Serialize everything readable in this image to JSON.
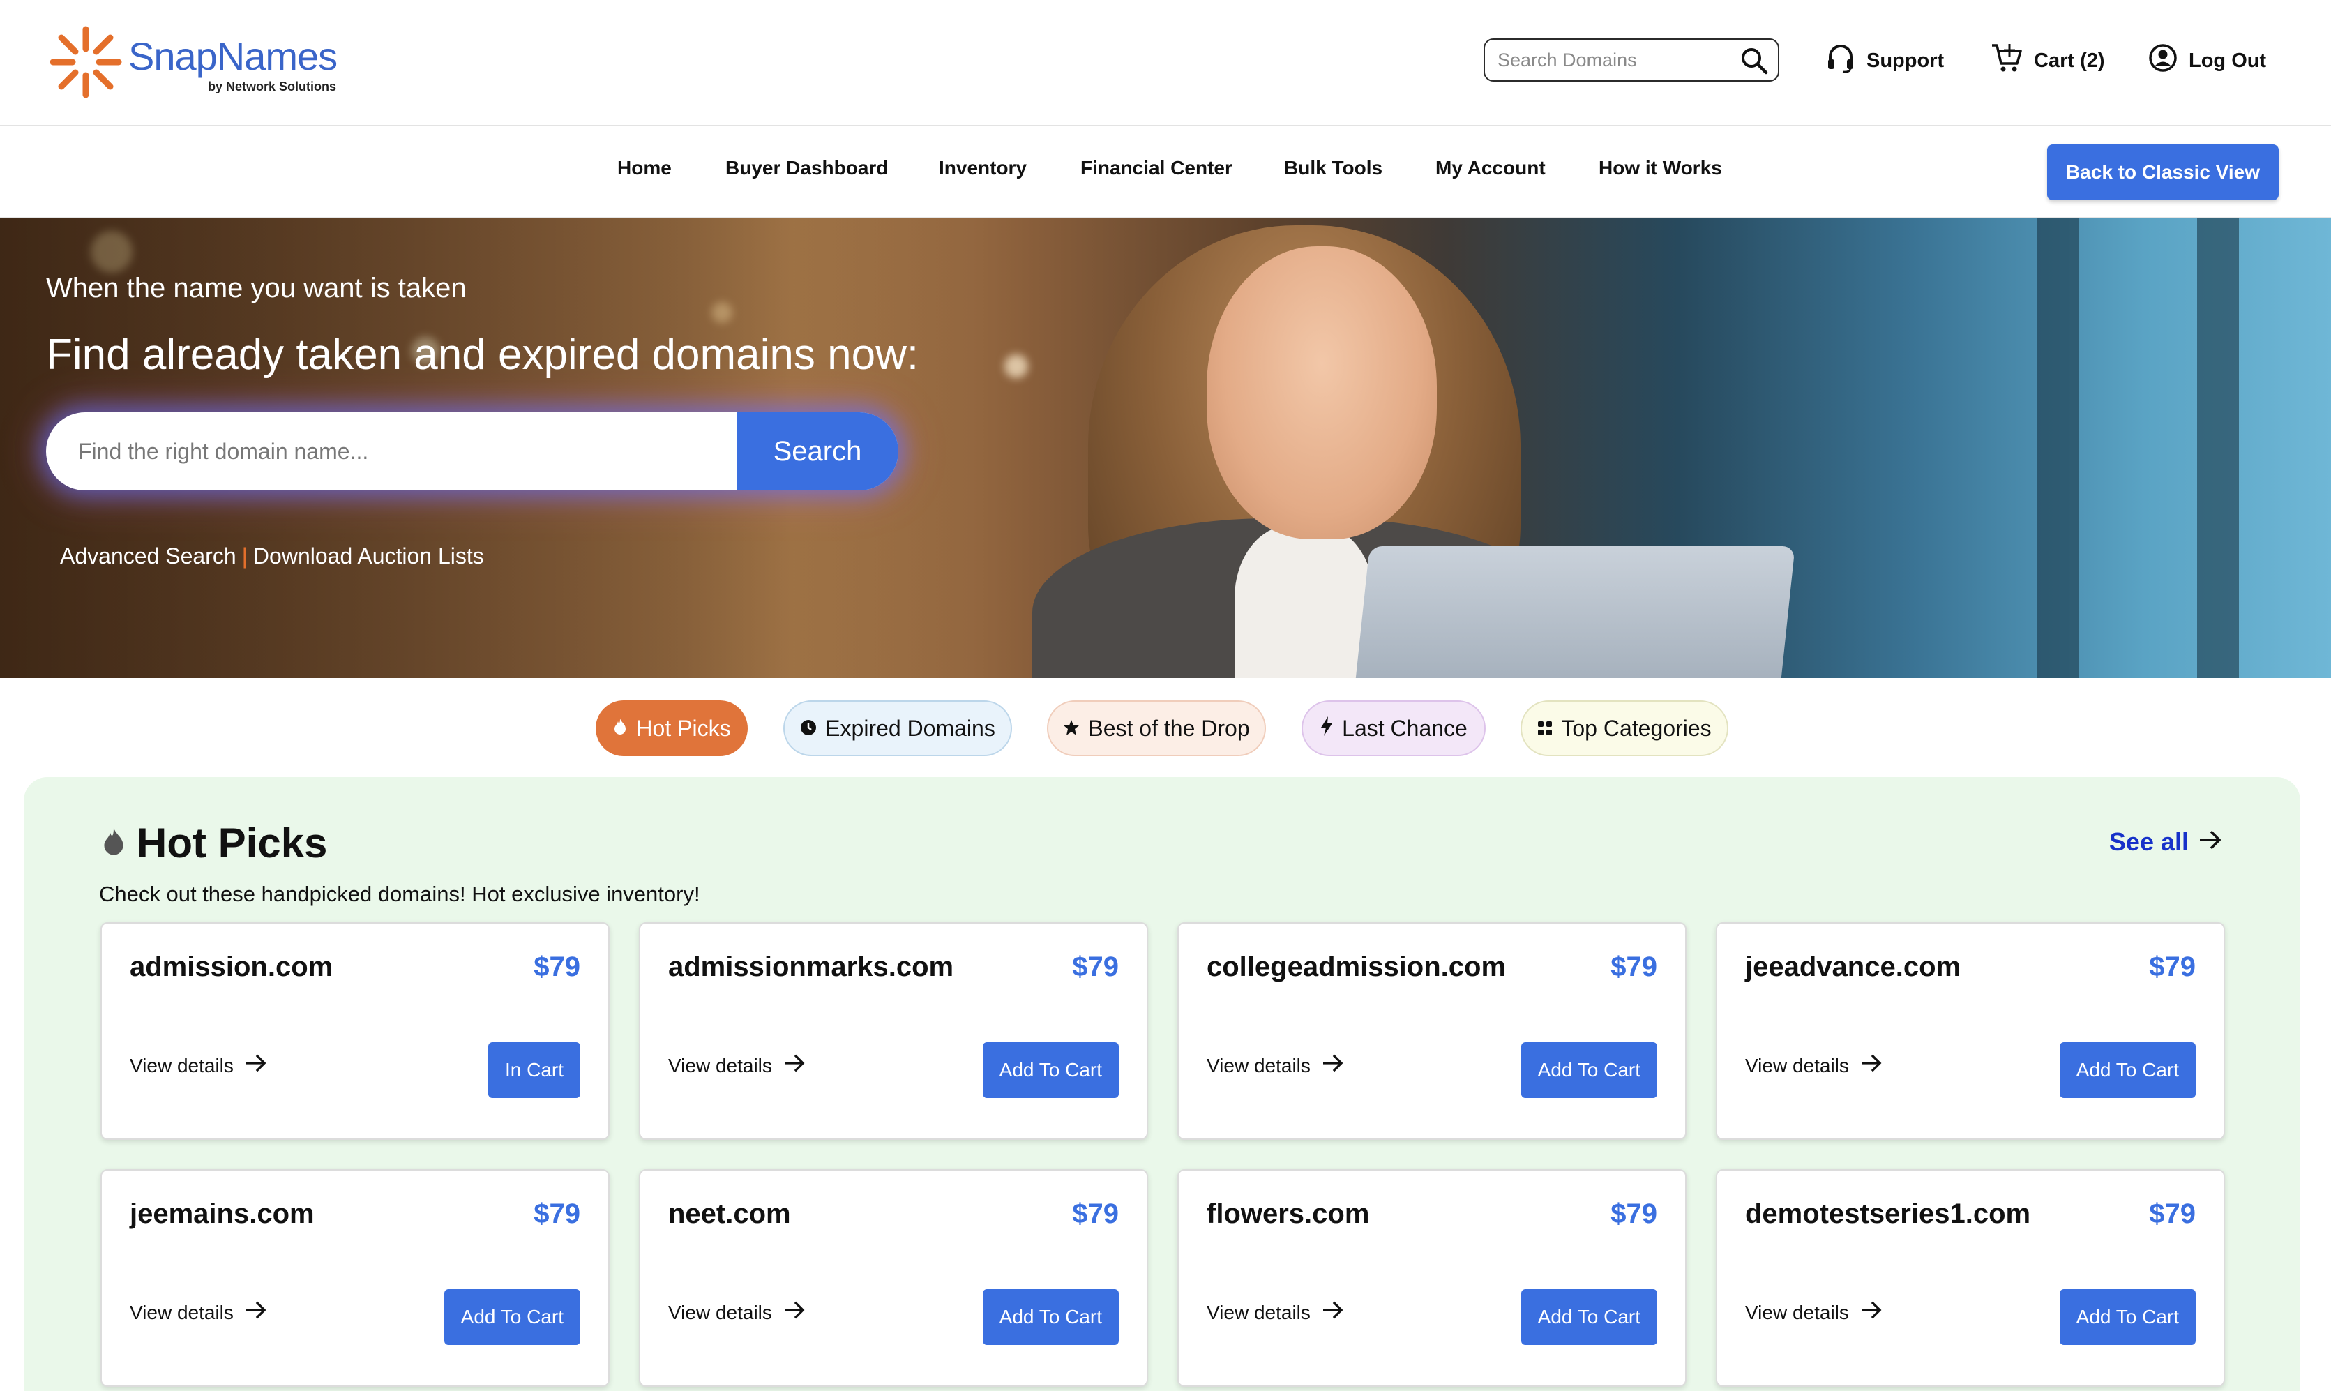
{
  "brand": {
    "name": "SnapNames",
    "sub": "by Network Solutions",
    "accent": "#e46f2b",
    "blue": "#3a6fe0"
  },
  "header": {
    "search_placeholder": "Search Domains",
    "support": "Support",
    "cart": "Cart (2)",
    "logout": "Log Out"
  },
  "nav": {
    "items": [
      "Home",
      "Buyer Dashboard",
      "Inventory",
      "Financial Center",
      "Bulk Tools",
      "My Account",
      "How it Works"
    ],
    "classic": "Back to Classic View"
  },
  "hero": {
    "subtitle": "When the name you want is taken",
    "title": "Find already taken and expired domains now:",
    "search_placeholder": "Find the right domain name...",
    "search_button": "Search",
    "link_advanced": "Advanced Search",
    "separator": "|",
    "link_download": "Download Auction Lists"
  },
  "tabs": [
    {
      "label": "Hot Picks",
      "icon": "flame-icon",
      "active": true
    },
    {
      "label": "Expired Domains",
      "icon": "clock-icon"
    },
    {
      "label": "Best of the Drop",
      "icon": "star-icon"
    },
    {
      "label": "Last Chance",
      "icon": "bolt-icon"
    },
    {
      "label": "Top Categories",
      "icon": "grid-icon"
    }
  ],
  "section": {
    "title": "Hot Picks",
    "description": "Check out these handpicked domains! Hot exclusive inventory!",
    "see_all": "See all"
  },
  "domains": [
    {
      "name": "admission.com",
      "price": "$79",
      "details": "View details",
      "action": "In Cart"
    },
    {
      "name": "admissionmarks.com",
      "price": "$79",
      "details": "View details",
      "action": "Add To Cart"
    },
    {
      "name": "collegeadmission.com",
      "price": "$79",
      "details": "View details",
      "action": "Add To Cart"
    },
    {
      "name": "jeeadvance.com",
      "price": "$79",
      "details": "View details",
      "action": "Add To Cart"
    },
    {
      "name": "jeemains.com",
      "price": "$79",
      "details": "View details",
      "action": "Add To Cart"
    },
    {
      "name": "neet.com",
      "price": "$79",
      "details": "View details",
      "action": "Add To Cart"
    },
    {
      "name": "flowers.com",
      "price": "$79",
      "details": "View details",
      "action": "Add To Cart"
    },
    {
      "name": "demotestseries1.com",
      "price": "$79",
      "details": "View details",
      "action": "Add To Cart"
    }
  ]
}
